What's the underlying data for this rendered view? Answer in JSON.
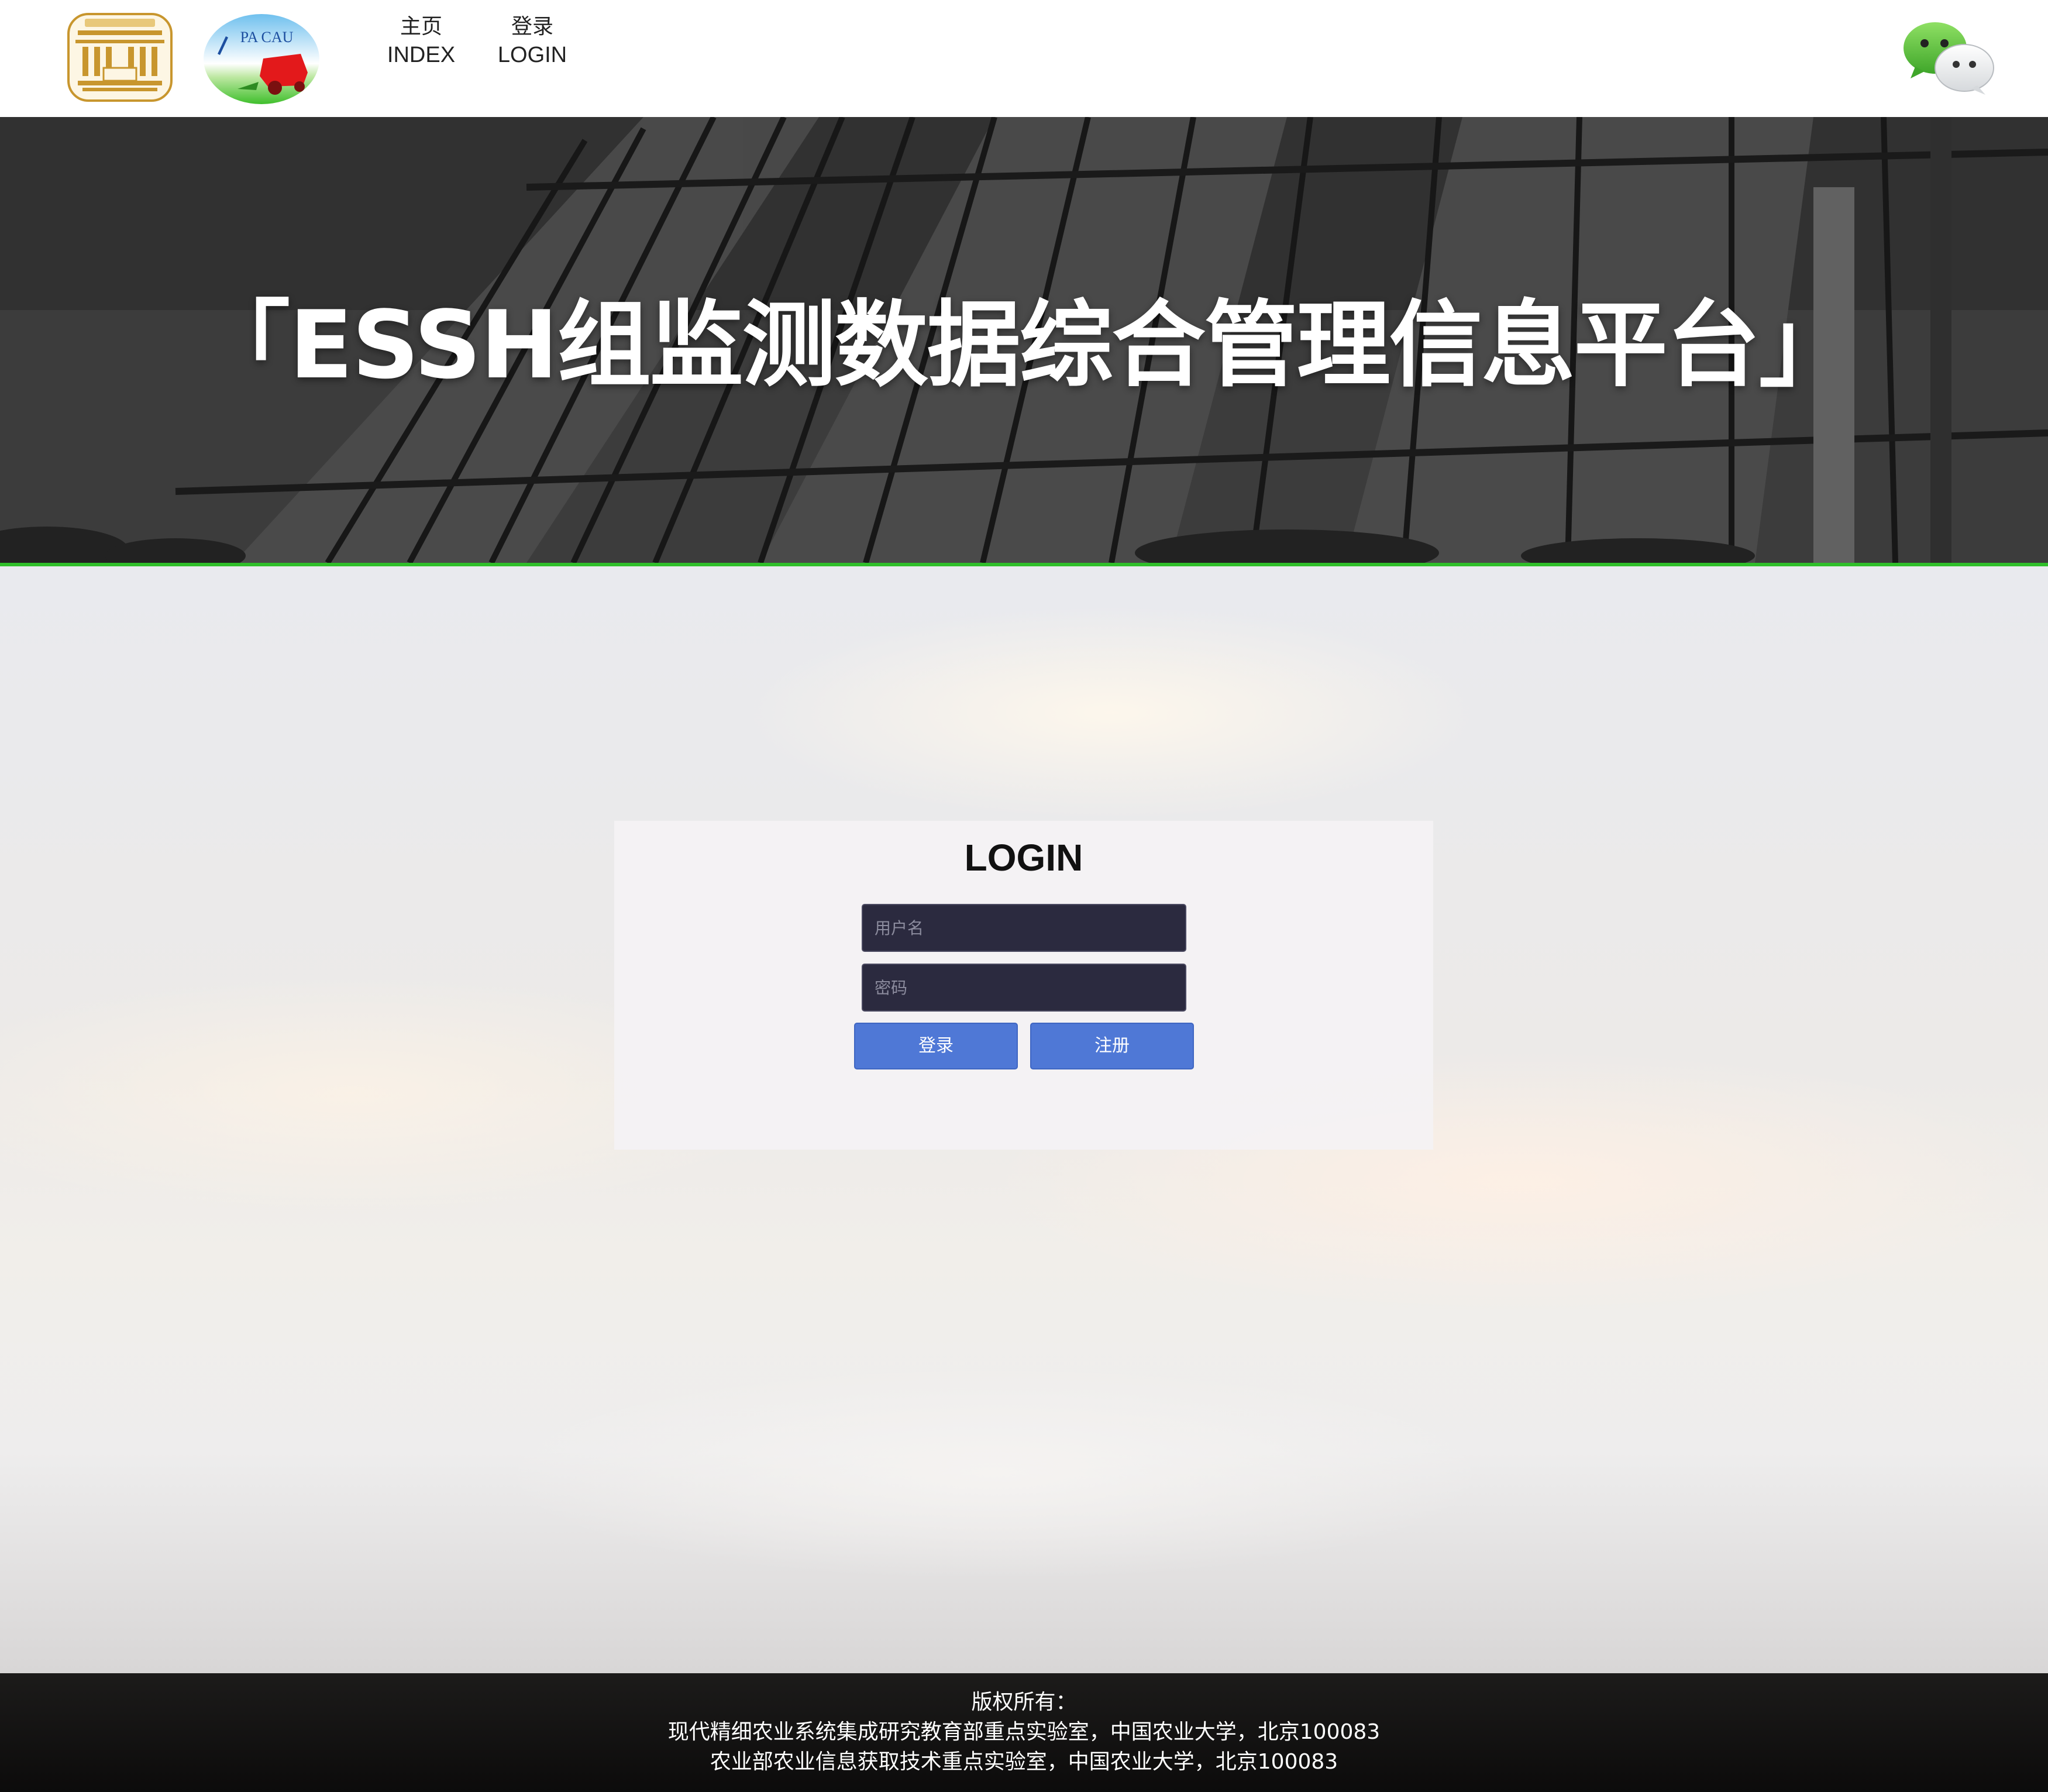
{
  "header": {
    "logo_cau_alt": "中国农业大学",
    "logo_pa_text": "PA CAU",
    "nav": [
      {
        "cn": "主页",
        "en": "INDEX"
      },
      {
        "cn": "登录",
        "en": "LOGIN"
      }
    ],
    "wechat_icon": "wechat-icon"
  },
  "hero": {
    "title": "「ESSH组监测数据综合管理信息平台」"
  },
  "login": {
    "title": "LOGIN",
    "username_placeholder": "用户名",
    "password_placeholder": "密码",
    "login_button": "登录",
    "register_button": "注册"
  },
  "footer": {
    "line1": "版权所有：",
    "line2": "现代精细农业系统集成研究教育部重点实验室，中国农业大学，北京100083",
    "line3": "农业部农业信息获取技术重点实验室，中国农业大学，北京100083"
  },
  "colors": {
    "accent_line": "#2fbf2a",
    "button": "#4f78d6",
    "field_bg": "#2b2a3f"
  }
}
